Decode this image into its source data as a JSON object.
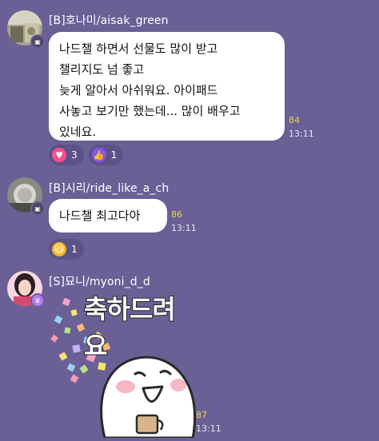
{
  "messages": [
    {
      "sender": "[B]호나미/aisak_green",
      "lines": [
        "나드챌 하면서 선물도 많이 받고",
        "챌리지도 넘 좋고",
        "늦게 알아서 아쉬워요. 아이패드",
        "사놓고 보기만 했는데... 많이 배우고",
        "있네요."
      ],
      "read_count": "84",
      "time": "13:11",
      "reactions": [
        {
          "icon": "heart-icon",
          "count": "3",
          "color": "#ff4d8d"
        },
        {
          "icon": "thumbs-up-icon",
          "count": "1",
          "color": "#8a54e8"
        }
      ]
    },
    {
      "sender": "[B]시리/ride_like_a_ch",
      "lines": [
        "나드챌 최고다아"
      ],
      "read_count": "86",
      "time": "13:11",
      "reactions": [
        {
          "icon": "grinning-emoji-icon",
          "count": "1",
          "color": "#f5b61e"
        }
      ]
    },
    {
      "sender": "[S]묘니/myoni_d_d",
      "sticker_text": "축하드려요",
      "read_count": "87",
      "time": "13:11"
    }
  ]
}
